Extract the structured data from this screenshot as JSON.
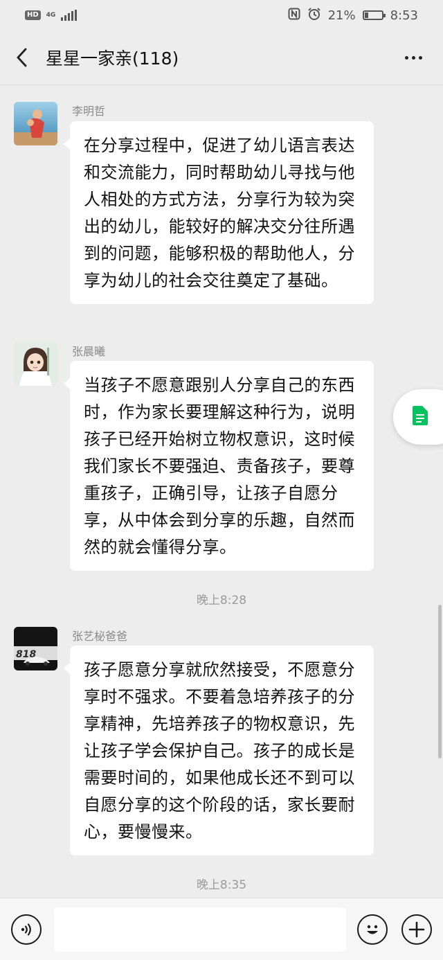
{
  "status_bar": {
    "hd": "HD",
    "network": "4G",
    "battery_text": "21%",
    "battery_level": 0.21,
    "time": "8:53"
  },
  "header": {
    "title": "星星一家亲(118)"
  },
  "messages": [
    {
      "sender": "李明哲",
      "text": "在分享过程中，促进了幼儿语言表达和交流能力，同时帮助幼儿寻找与他人相处的方式方法，分享行为较为突出的幼儿，能较好的解决交分往所遇到的问题，能够积极的帮助他人，分享为幼儿的社会交往奠定了基础。"
    },
    {
      "sender": "张晨曦",
      "text": "当孩子不愿意跟别人分享自己的东西时，作为家长要理解这种行为，说明孩子已经开始树立物权意识，这时候我们家长不要强迫、责备孩子，要尊重孩子，正确引导，让孩子自愿分享，从中体会到分享的乐趣，自然而然的就会懂得分享。"
    },
    {
      "sender": "张艺柲爸爸",
      "text": "孩子愿意分享就欣然接受，不愿意分享时不强求。不要着急培养孩子的分享精神，先培养孩子的物权意识，先让孩子学会保护自己。孩子的成长是需要时间的，如果他成长还不到可以自愿分享的这个阶段的话，家长要耐心，要慢慢来。"
    }
  ],
  "timestamps": [
    "晚上8:28",
    "晚上8:35"
  ],
  "avatar3_text": "818",
  "input": {
    "value": "",
    "placeholder": ""
  },
  "colors": {
    "background": "#ededed",
    "bubble": "#ffffff",
    "doc_icon": "#07c160"
  }
}
